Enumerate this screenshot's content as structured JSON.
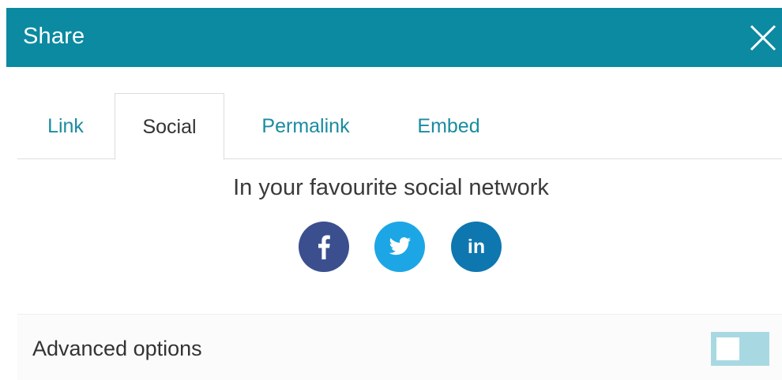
{
  "dialog": {
    "title": "Share",
    "close_icon": "close-icon"
  },
  "tabs": [
    {
      "label": "Link",
      "active": false
    },
    {
      "label": "Social",
      "active": true
    },
    {
      "label": "Permalink",
      "active": false
    },
    {
      "label": "Embed",
      "active": false
    }
  ],
  "social": {
    "heading": "In your favourite social network",
    "networks": [
      {
        "name": "facebook",
        "icon": "facebook-icon",
        "color": "#3b4f8f"
      },
      {
        "name": "twitter",
        "icon": "twitter-icon",
        "color": "#1da6e6"
      },
      {
        "name": "linkedin",
        "icon": "linkedin-icon",
        "glyph": "in",
        "color": "#0e77b0"
      }
    ]
  },
  "advanced": {
    "label": "Advanced options",
    "toggle_on": false
  },
  "colors": {
    "header_bg": "#0b8aa1",
    "tab_text": "#1a8ca0",
    "toggle_bg": "#a8d9e2"
  }
}
